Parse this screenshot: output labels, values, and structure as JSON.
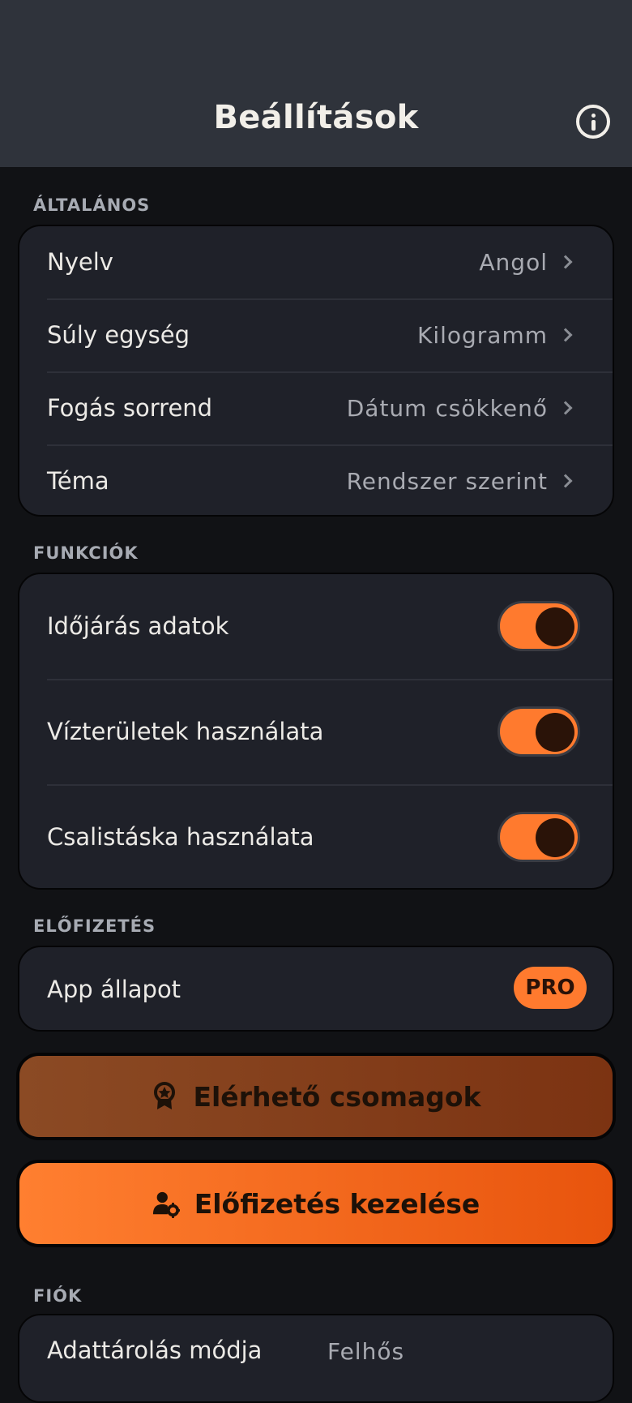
{
  "header": {
    "title": "Beállítások",
    "info_icon": "info-circle-icon"
  },
  "general": {
    "section_label": "ÁLTALÁNOS",
    "items": [
      {
        "label": "Nyelv",
        "value": "Angol"
      },
      {
        "label": "Súly egység",
        "value": "Kilogramm"
      },
      {
        "label": "Fogás sorrend",
        "value": "Dátum csökkenő"
      },
      {
        "label": "Téma",
        "value": "Rendszer szerint"
      }
    ]
  },
  "features": {
    "section_label": "FUNKCIÓK",
    "items": [
      {
        "label": "Időjárás adatok",
        "enabled": true
      },
      {
        "label": "Vízterületek használata",
        "enabled": true
      },
      {
        "label": "Csalistáska használata",
        "enabled": true
      }
    ]
  },
  "subscription": {
    "section_label": "ELŐFIZETÉS",
    "status_label": "App állapot",
    "status_badge": "PRO",
    "packages_button": "Elérhető csomagok",
    "manage_button": "Előfizetés kezelése"
  },
  "account": {
    "section_label": "FIÓK",
    "storage_label": "Adattárolás módja",
    "storage_value": "Felhős"
  },
  "colors": {
    "accent": "#ff7a2e",
    "background": "#111215",
    "card": "#1f2129",
    "header": "#2f333b"
  }
}
